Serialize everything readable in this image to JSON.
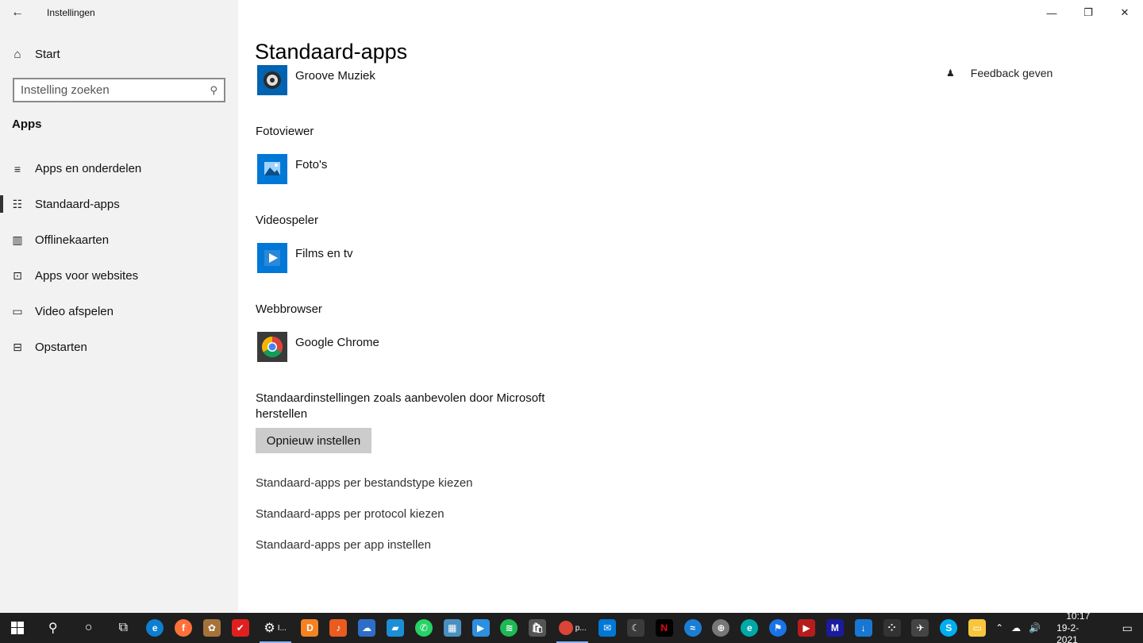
{
  "window": {
    "title": "Instellingen",
    "back_icon": "←",
    "controls": [
      "—",
      "❐",
      "✕"
    ]
  },
  "sidebar": {
    "home_label": "Start",
    "search_placeholder": "Instelling zoeken",
    "section_title": "Apps",
    "items": [
      {
        "label": "Apps en onderdelen",
        "icon": "≡"
      },
      {
        "label": "Standaard-apps",
        "icon": "☷"
      },
      {
        "label": "Offlinekaarten",
        "icon": "▥"
      },
      {
        "label": "Apps voor websites",
        "icon": "⊡"
      },
      {
        "label": "Video afspelen",
        "icon": "▭"
      },
      {
        "label": "Opstarten",
        "icon": "⊟"
      }
    ]
  },
  "main": {
    "title": "Standaard-apps",
    "feedback": "Feedback geven",
    "sections": [
      {
        "category": "",
        "app": "Groove Muziek"
      },
      {
        "category": "Fotoviewer",
        "app": "Foto's"
      },
      {
        "category": "Videospeler",
        "app": "Films en tv"
      },
      {
        "category": "Webbrowser",
        "app": "Google Chrome"
      }
    ],
    "reset_text": "Standaardinstellingen zoals aanbevolen door Microsoft herstellen",
    "reset_button": "Opnieuw instellen",
    "links": [
      "Standaard-apps per bestandstype kiezen",
      "Standaard-apps per protocol kiezen",
      "Standaard-apps per app instellen"
    ]
  },
  "taskbar": {
    "settings_label": "I...",
    "chrome_label": "p...",
    "time": "10:17",
    "date": "19-2-2021",
    "colors": {
      "accent": "#0078d7",
      "background": "#1f1f1f",
      "sidebar": "#f2f2f2"
    }
  }
}
